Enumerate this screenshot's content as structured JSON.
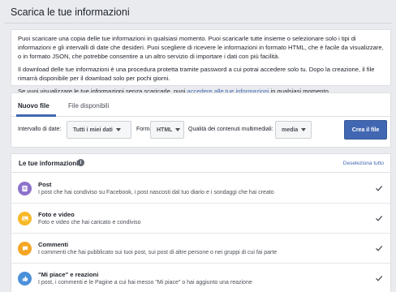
{
  "header": {
    "title": "Scarica le tue informazioni"
  },
  "info": {
    "paragraph1": "Puoi scaricare una copia delle tue informazioni in qualsiasi momento. Puoi scaricarle tutte insieme o selezionare solo i tipi di informazioni e gli intervalli di date che desideri. Puoi scegliere di ricevere le informazioni in formato HTML, che è facile da visualizzare, o in formato JSON, che potrebbe consentire a un altro servizio di importare i dati con più facilità.",
    "paragraph2": "Il download delle tue informazioni è una procedura protetta tramite password a cui potrai accedere solo tu. Dopo la creazione, il file rimarrà disponibile per il download solo per pochi giorni.",
    "paragraph3_prefix": "Se vuoi visualizzare le tue informazioni senza scaricarle, puoi ",
    "paragraph3_link": "accedere alle tue informazioni",
    "paragraph3_suffix": " in qualsiasi momento."
  },
  "tabs": {
    "new_file": "Nuovo file",
    "available_files": "File disponibili"
  },
  "options": {
    "date_range_label": "Intervallo di date:",
    "date_range_value": "Tutti i miei dati",
    "format_label": "Formato:",
    "format_value": "HTML",
    "media_quality_label": "Qualità dei contenuti multimediali:",
    "media_quality_value": "media",
    "create_button": "Crea il file"
  },
  "list": {
    "title": "Le tue informazioni",
    "deselect_all": "Deseleziona tutto",
    "items": [
      {
        "title": "Post",
        "description": "I post che hai condiviso su Facebook, i post nascosti dal tuo diario e i sondaggi che hai creato",
        "icon": "post-icon",
        "color": "#8c72cb",
        "checked": true
      },
      {
        "title": "Foto e video",
        "description": "Foto e video che hai caricato e condiviso",
        "icon": "photo-icon",
        "color": "#f7b928",
        "checked": true
      },
      {
        "title": "Commenti",
        "description": "I commenti che hai pubblicato sui tuoi post, sui post di altre persone o nei gruppi di cui fai parte",
        "icon": "comment-icon",
        "color": "#f5a623",
        "checked": true
      },
      {
        "title": "\"Mi piace\" e reazioni",
        "description": "I post, i commenti e le Pagine a cui hai messo \"Mi piace\" o hai aggiunto una reazione",
        "icon": "like-icon",
        "color": "#4a90d9",
        "checked": true
      }
    ]
  },
  "colors": {
    "accent": "#4267b2",
    "background": "#e9ebee"
  }
}
